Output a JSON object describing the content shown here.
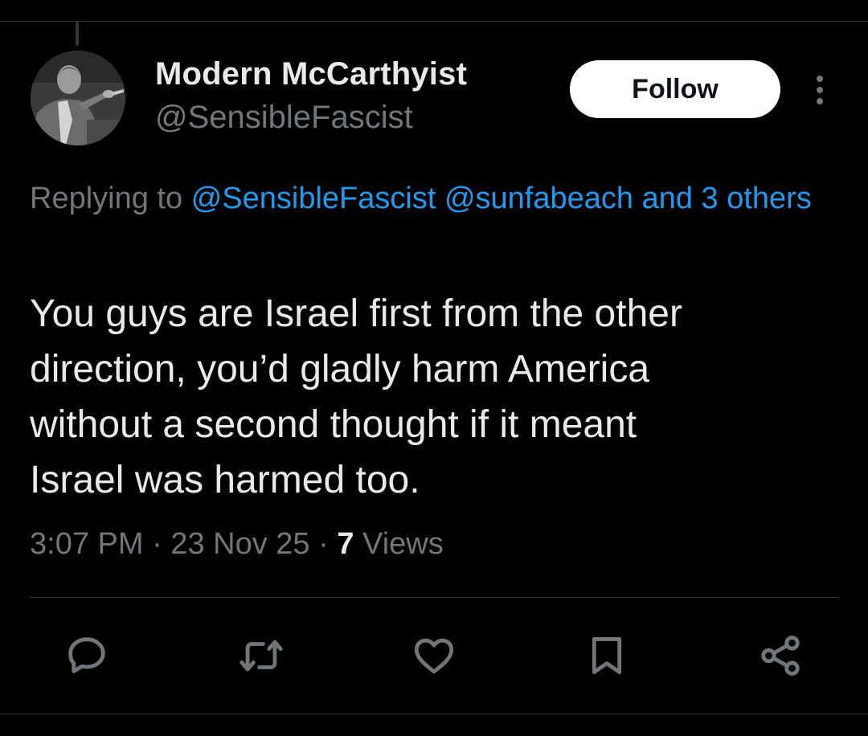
{
  "tweet": {
    "author": {
      "display_name": "Modern McCarthyist",
      "handle": "@SensibleFascist",
      "avatar_icon": "avatar-photo"
    },
    "follow_label": "Follow",
    "more_icon": "more-options-icon",
    "replying": {
      "prefix": "Replying to",
      "mentions": [
        "@SensibleFascist",
        "@sunfabeach"
      ],
      "others_label": "and 3 others"
    },
    "text_lines": [
      "You guys are Israel first from the other",
      "direction, you’d gladly harm America",
      "without a second thought if it meant",
      "Israel was harmed too."
    ],
    "meta": {
      "time": "3:07 PM",
      "date": "23 Nov 25",
      "separator": "·",
      "views_count": "7",
      "views_label": "Views"
    },
    "actions": [
      {
        "name": "reply",
        "icon": "reply-icon"
      },
      {
        "name": "repost",
        "icon": "repost-icon"
      },
      {
        "name": "like",
        "icon": "heart-icon"
      },
      {
        "name": "bookmark",
        "icon": "bookmark-icon"
      },
      {
        "name": "share",
        "icon": "share-icon"
      }
    ]
  },
  "colors": {
    "background": "#000000",
    "primary_text": "#e7e9ea",
    "secondary_text": "#71767b",
    "link": "#1d9bf0",
    "follow_button_bg": "#ffffff",
    "divider": "#2f3336"
  }
}
